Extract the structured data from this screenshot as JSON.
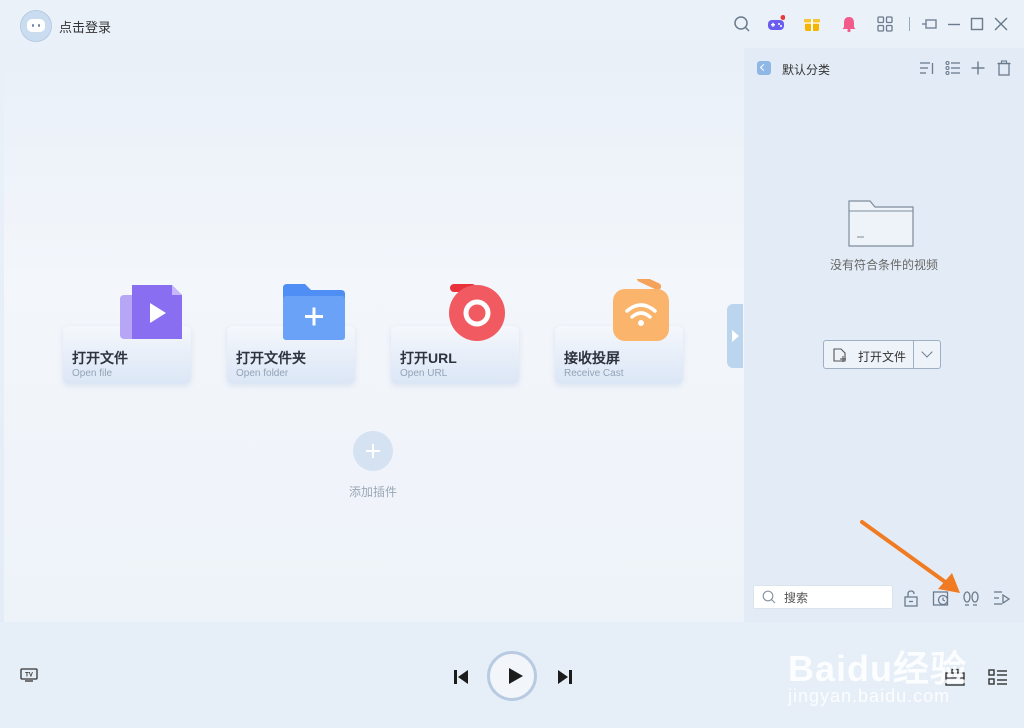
{
  "header": {
    "login_label": "点击登录",
    "icons": [
      "search-icon",
      "game-icon",
      "gift-icon",
      "bell-icon",
      "apps-icon",
      "mini-mode-icon",
      "minimize-icon",
      "maximize-icon",
      "close-icon"
    ],
    "game_badge_color": "#e93a3a"
  },
  "actions": [
    {
      "title": "打开文件",
      "subtitle": "Open file",
      "icon": "video-file-icon"
    },
    {
      "title": "打开文件夹",
      "subtitle": "Open folder",
      "icon": "folder-add-icon"
    },
    {
      "title": "打开URL",
      "subtitle": "Open URL",
      "icon": "url-icon"
    },
    {
      "title": "接收投屏",
      "subtitle": "Receive Cast",
      "icon": "cast-icon"
    }
  ],
  "plugin": {
    "label": "添加插件"
  },
  "sidebar": {
    "category_title": "默认分类",
    "empty_text": "没有符合条件的视频",
    "open_file_label": "打开文件",
    "search_placeholder": "搜索"
  },
  "colors": {
    "accent": "#8fb8e6",
    "annotation_arrow": "#f07b22"
  },
  "watermark": {
    "brand": "Baidu经验",
    "site": "jingyan.baidu.com"
  }
}
